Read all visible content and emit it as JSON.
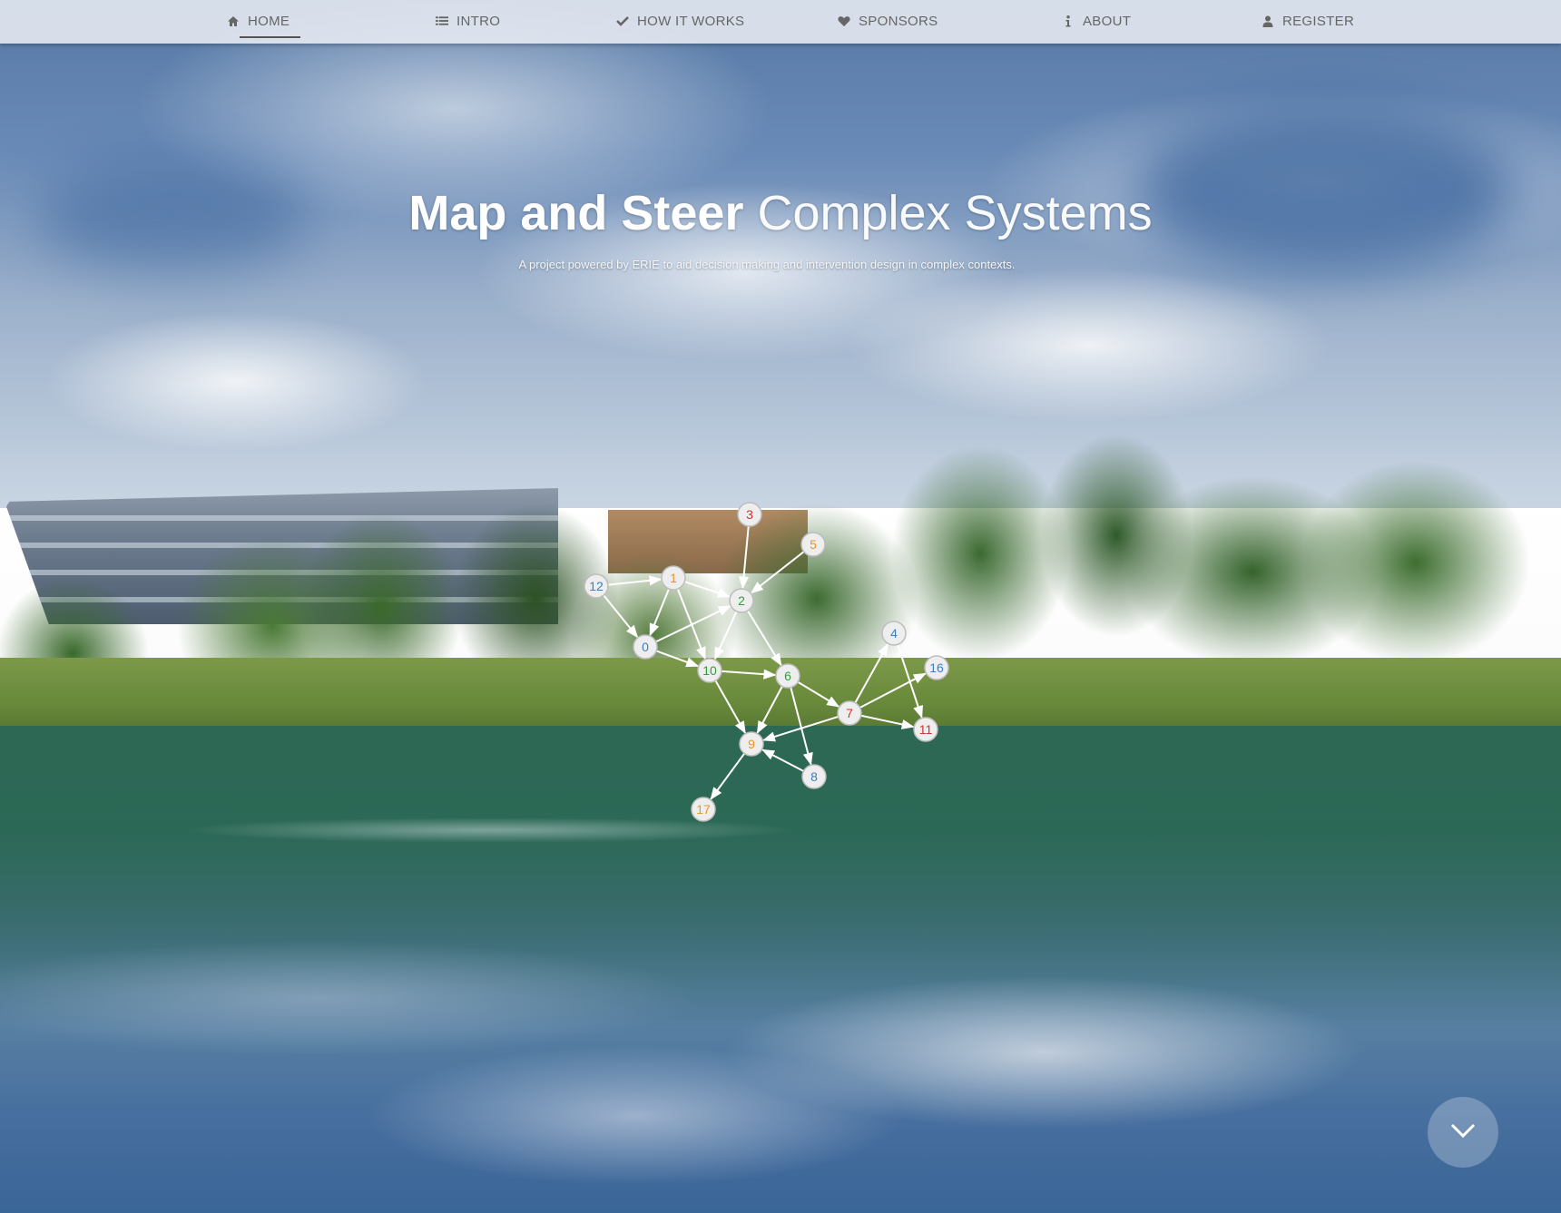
{
  "nav": {
    "items": [
      {
        "label": "HOME",
        "icon": "home-icon",
        "active": true
      },
      {
        "label": "INTRO",
        "icon": "list-icon",
        "active": false
      },
      {
        "label": "HOW IT WORKS",
        "icon": "check-icon",
        "active": false
      },
      {
        "label": "SPONSORS",
        "icon": "heart-icon",
        "active": false
      },
      {
        "label": "ABOUT",
        "icon": "info-icon",
        "active": false
      },
      {
        "label": "REGISTER",
        "icon": "user-icon",
        "active": false
      }
    ]
  },
  "hero": {
    "title_bold": "Map and Steer",
    "title_light": "Complex Systems",
    "subtitle": "A project powered by ERIE to aid decision making and intervention design in complex contexts."
  },
  "graph": {
    "nodes": [
      {
        "id": "0",
        "color": "#3a7fc2"
      },
      {
        "id": "1",
        "color": "#e7962a"
      },
      {
        "id": "2",
        "color": "#2f9e3b"
      },
      {
        "id": "3",
        "color": "#d0342c"
      },
      {
        "id": "4",
        "color": "#3a7fc2"
      },
      {
        "id": "5",
        "color": "#e7962a"
      },
      {
        "id": "6",
        "color": "#2f9e3b"
      },
      {
        "id": "7",
        "color": "#d0342c"
      },
      {
        "id": "8",
        "color": "#3a7fc2"
      },
      {
        "id": "9",
        "color": "#e7962a"
      },
      {
        "id": "10",
        "color": "#2f9e3b"
      },
      {
        "id": "11",
        "color": "#d0342c"
      },
      {
        "id": "12",
        "color": "#3a7fc2"
      },
      {
        "id": "16",
        "color": "#3a7fc2"
      },
      {
        "id": "17",
        "color": "#e7962a"
      }
    ],
    "edges": [
      [
        "12",
        "1"
      ],
      [
        "12",
        "0"
      ],
      [
        "1",
        "0"
      ],
      [
        "1",
        "2"
      ],
      [
        "1",
        "10"
      ],
      [
        "0",
        "2"
      ],
      [
        "0",
        "10"
      ],
      [
        "3",
        "2"
      ],
      [
        "5",
        "2"
      ],
      [
        "2",
        "6"
      ],
      [
        "2",
        "10"
      ],
      [
        "10",
        "6"
      ],
      [
        "10",
        "9"
      ],
      [
        "6",
        "9"
      ],
      [
        "6",
        "7"
      ],
      [
        "6",
        "8"
      ],
      [
        "7",
        "4"
      ],
      [
        "7",
        "11"
      ],
      [
        "7",
        "16"
      ],
      [
        "4",
        "11"
      ],
      [
        "7",
        "9"
      ],
      [
        "8",
        "9"
      ],
      [
        "9",
        "17"
      ]
    ]
  },
  "scroll_button": {
    "icon": "chevron-down-icon"
  }
}
